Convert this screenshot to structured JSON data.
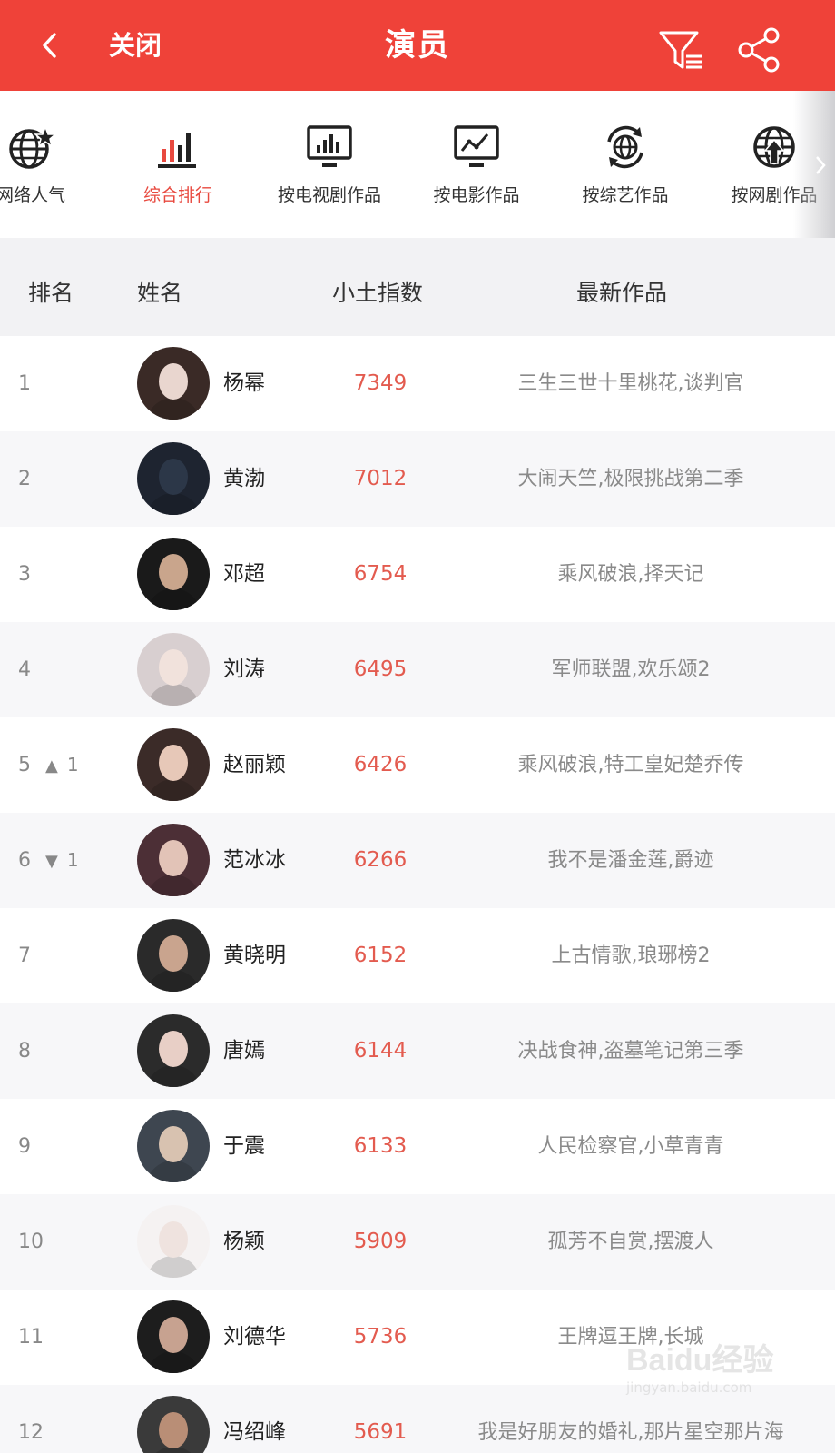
{
  "header": {
    "close_label": "关闭",
    "title": "演员",
    "back_icon": "chevron-left-icon",
    "filter_icon": "filter-icon",
    "share_icon": "share-icon"
  },
  "categories": [
    {
      "label": "网络人气",
      "icon": "globe-star-icon",
      "active": false
    },
    {
      "label": "综合排行",
      "icon": "bar-chart-icon",
      "active": true
    },
    {
      "label": "按电视剧作品",
      "icon": "tv-chart-icon",
      "active": false
    },
    {
      "label": "按电影作品",
      "icon": "monitor-trend-icon",
      "active": false
    },
    {
      "label": "按综艺作品",
      "icon": "globe-refresh-icon",
      "active": false
    },
    {
      "label": "按网剧作品",
      "icon": "globe-upload-icon",
      "active": false
    }
  ],
  "table": {
    "headers": {
      "rank": "排名",
      "name": "姓名",
      "index": "小土指数",
      "works": "最新作品"
    },
    "rows": [
      {
        "rank": "1",
        "trend": "",
        "trend_value": "",
        "name": "杨幂",
        "score": "7349",
        "works": "三生三世十里桃花,谈判官"
      },
      {
        "rank": "2",
        "trend": "",
        "trend_value": "",
        "name": "黄渤",
        "score": "7012",
        "works": "大闹天竺,极限挑战第二季"
      },
      {
        "rank": "3",
        "trend": "",
        "trend_value": "",
        "name": "邓超",
        "score": "6754",
        "works": "乘风破浪,择天记"
      },
      {
        "rank": "4",
        "trend": "",
        "trend_value": "",
        "name": "刘涛",
        "score": "6495",
        "works": "军师联盟,欢乐颂2"
      },
      {
        "rank": "5",
        "trend": "▲",
        "trend_value": "1",
        "name": "赵丽颖",
        "score": "6426",
        "works": "乘风破浪,特工皇妃楚乔传"
      },
      {
        "rank": "6",
        "trend": "▼",
        "trend_value": "1",
        "name": "范冰冰",
        "score": "6266",
        "works": "我不是潘金莲,爵迹"
      },
      {
        "rank": "7",
        "trend": "",
        "trend_value": "",
        "name": "黄晓明",
        "score": "6152",
        "works": "上古情歌,琅琊榜2"
      },
      {
        "rank": "8",
        "trend": "",
        "trend_value": "",
        "name": "唐嫣",
        "score": "6144",
        "works": "决战食神,盗墓笔记第三季"
      },
      {
        "rank": "9",
        "trend": "",
        "trend_value": "",
        "name": "于震",
        "score": "6133",
        "works": "人民检察官,小草青青"
      },
      {
        "rank": "10",
        "trend": "",
        "trend_value": "",
        "name": "杨颖",
        "score": "5909",
        "works": "孤芳不自赏,摆渡人"
      },
      {
        "rank": "11",
        "trend": "",
        "trend_value": "",
        "name": "刘德华",
        "score": "5736",
        "works": "王牌逗王牌,长城"
      },
      {
        "rank": "12",
        "trend": "",
        "trend_value": "",
        "name": "冯绍峰",
        "score": "5691",
        "works": "我是好朋友的婚礼,那片星空那片海"
      }
    ]
  },
  "watermark": {
    "brand": "Baidu经验",
    "url": "jingyan.baidu.com"
  },
  "colors": {
    "header_bg": "#ef4239",
    "accent": "#e8493f",
    "score": "#e35b4f"
  }
}
